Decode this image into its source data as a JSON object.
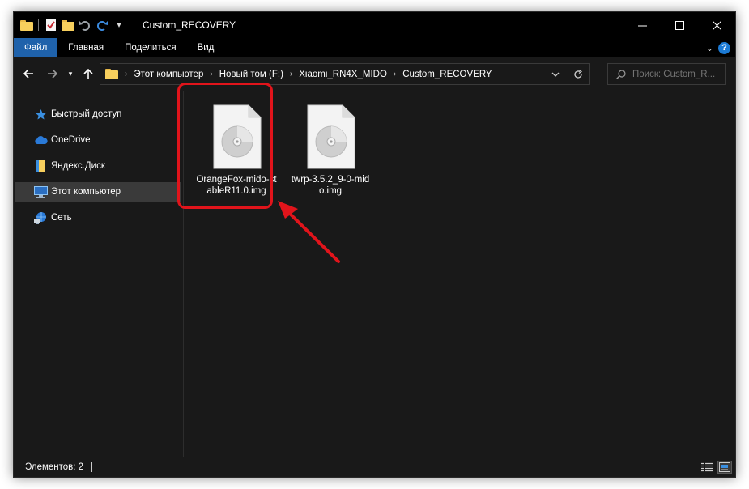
{
  "window": {
    "title": "Custom_RECOVERY"
  },
  "ribbon": {
    "tabs": [
      {
        "label": "Файл",
        "active": true
      },
      {
        "label": "Главная",
        "active": false
      },
      {
        "label": "Поделиться",
        "active": false
      },
      {
        "label": "Вид",
        "active": false
      }
    ]
  },
  "address": {
    "breadcrumbs": [
      "Этот компьютер",
      "Новый том (F:)",
      "Xiaomi_RN4X_MIDO",
      "Custom_RECOVERY"
    ]
  },
  "search": {
    "placeholder": "Поиск: Custom_R..."
  },
  "sidebar": {
    "items": [
      {
        "label": "Быстрый доступ",
        "icon": "star-icon",
        "selected": false
      },
      {
        "label": "OneDrive",
        "icon": "cloud-icon",
        "selected": false
      },
      {
        "label": "Яндекс.Диск",
        "icon": "yandex-disk-icon",
        "selected": false
      },
      {
        "label": "Этот компьютер",
        "icon": "computer-icon",
        "selected": true
      },
      {
        "label": "Сеть",
        "icon": "network-icon",
        "selected": false
      }
    ]
  },
  "files": [
    {
      "name": "OrangeFox-mido-stableR11.0.img",
      "icon": "disc-image-icon",
      "highlighted": true
    },
    {
      "name": "twrp-3.5.2_9-0-mido.img",
      "icon": "disc-image-icon",
      "highlighted": false
    }
  ],
  "status": {
    "items_count": "Элементов: 2"
  },
  "colors": {
    "accent": "#1f62ab",
    "highlight": "#e1141b",
    "background": "#191919"
  }
}
